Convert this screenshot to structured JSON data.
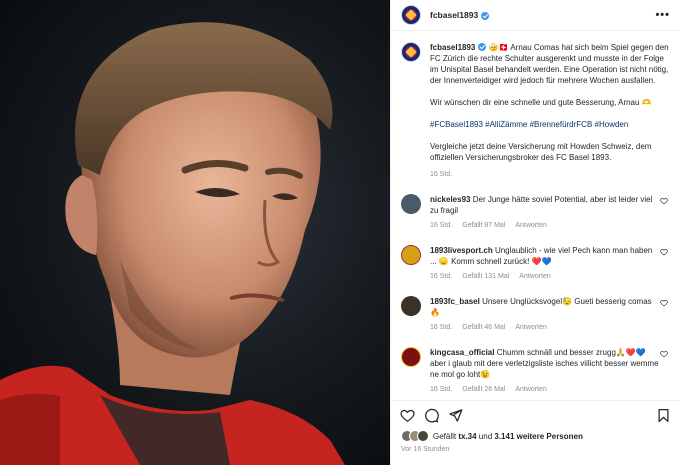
{
  "post": {
    "account": "fcbasel1893",
    "more_label": "•••"
  },
  "caption": {
    "username": "fcbasel1893",
    "paragraph1": "🤕🇨🇭 Arnau Comas hat sich beim Spiel gegen den FC Zürich die rechte Schulter ausgerenkt und musste in der Folge im Unispital Basel behandelt werden. Eine Operation ist nicht nötig, der Innenverteidiger wird jedoch für mehrere Wochen ausfallen.",
    "paragraph2": "Wir wünschen dir eine schnelle und gute Besserung, Arnau 🫶",
    "hashtags": "#FCBasel1893 #AlliZämme #BrennefürdrFCB #Howden",
    "paragraph3": "Vergleiche jetzt deine Versicherung mit Howden Schweiz, dem offiziellen Versicherungsbroker des FC Basel 1893.",
    "time": "16 Std."
  },
  "comments": [
    {
      "username": "nickeles93",
      "text": "Der Junge hätte soviel Potential, aber ist leider viel zu fragil",
      "time": "16 Std.",
      "likes": "Gefällt 87 Mal",
      "reply": "Antworten",
      "avatar_color": "#4a5a6a"
    },
    {
      "username": "1893livesport.ch",
      "text": "Unglaublich - wie viel Pech kann man haben ... 😞 Komm schnell zurück! ❤️💙",
      "time": "16 Std.",
      "likes": "Gefällt 131 Mal",
      "reply": "Antworten",
      "avatar_color": "#d4a017"
    },
    {
      "username": "1893fc_basel",
      "text": "Unsere Unglücksvogel😓 Gueti besserig comas 🔥",
      "time": "16 Std.",
      "likes": "Gefällt 46 Mal",
      "reply": "Antworten",
      "avatar_color": "#3b3226"
    },
    {
      "username": "kingcasa_official",
      "text": "Chumm schnäll und besser zrugg🙏❤️💙 aber i glaub mit dere verletzigsliste isches viilicht besser wemme ne mol go loht😉",
      "time": "16 Std.",
      "likes": "Gefällt 26 Mal",
      "reply": "Antworten",
      "avatar_color": "#7a1010"
    }
  ],
  "likes": {
    "prefix": "Gefällt ",
    "user": "tx.34",
    "middle": " und ",
    "count": "3.141 weitere Personen"
  },
  "posted_ago": "Vor 16 Stunden",
  "colors": {
    "hashtag": "#00376b",
    "verified": "#3897f0",
    "muted": "#8e8e8e"
  },
  "icons": [
    "heart-icon",
    "comment-icon",
    "share-icon",
    "bookmark-icon",
    "verified-icon",
    "more-icon"
  ]
}
